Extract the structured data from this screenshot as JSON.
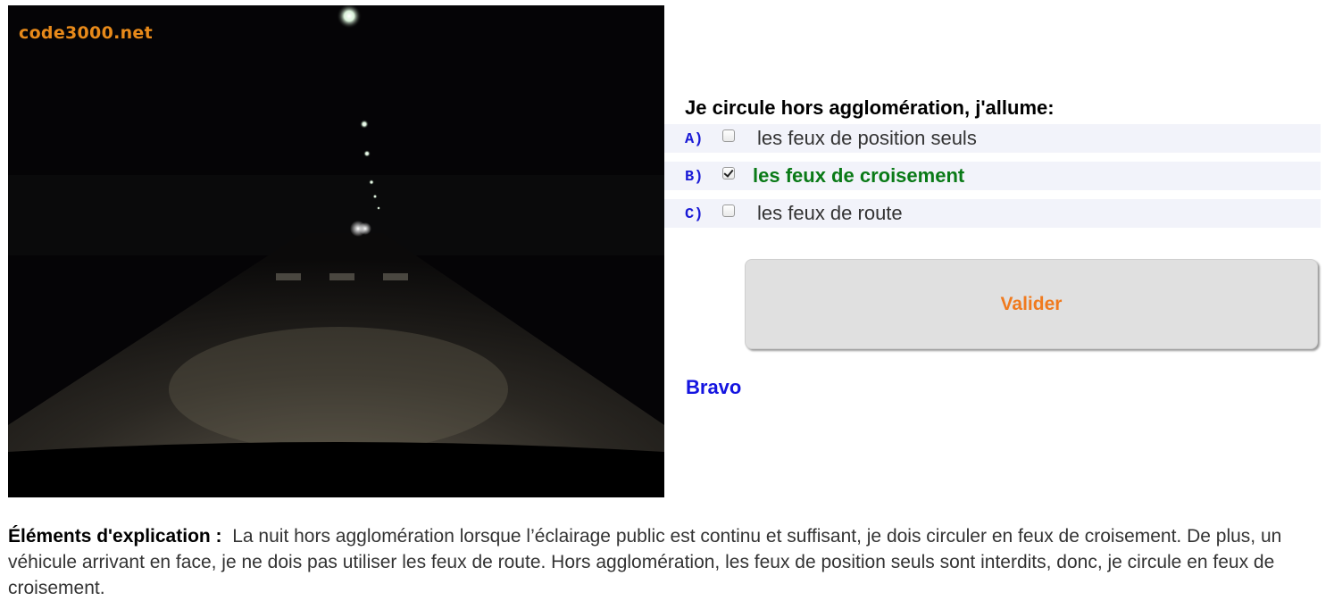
{
  "photo": {
    "watermark": "code3000.net"
  },
  "question": {
    "text": "Je circule hors agglomération, j'allume:"
  },
  "answers": [
    {
      "letter": "A)",
      "text": "les feux de position seuls",
      "checked": false,
      "correct": false
    },
    {
      "letter": "B)",
      "text": "les feux de croisement",
      "checked": true,
      "correct": true
    },
    {
      "letter": "C)",
      "text": "les feux de route",
      "checked": false,
      "correct": false
    }
  ],
  "validate_label": "Valider",
  "feedback": "Bravo",
  "explanation": {
    "label": "Éléments d'explication :",
    "text": "La nuit hors agglomération lorsque l’éclairage public est continu et suffisant, je dois circuler en feux de croisement. De plus, un véhicule arrivant en face, je ne dois pas utiliser les feux de route. Hors agglomération, les feux de position seuls sont interdits, donc, je circule en feux de croisement."
  },
  "colors": {
    "letter": "#1a1ad6",
    "correct_answer": "#0a7a17",
    "validate_text": "#f07a1e",
    "feedback": "#1414e0",
    "watermark": "#e88a1a"
  }
}
